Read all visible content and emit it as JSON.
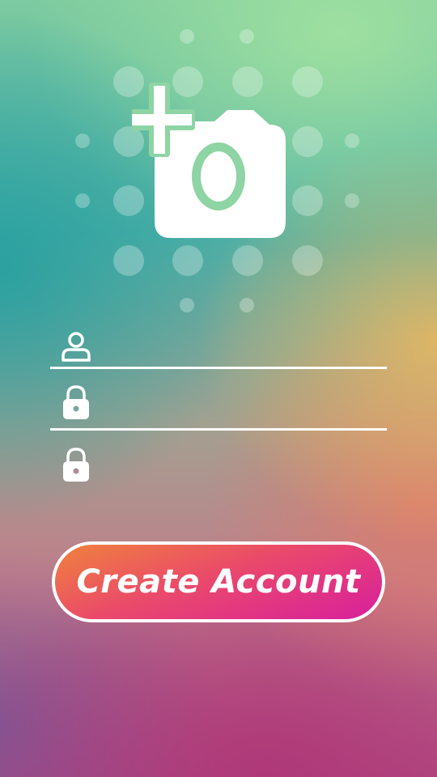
{
  "colors": {
    "accent_green": "#8fd4a4",
    "button_gradient_start": "#f0823c",
    "button_gradient_end": "#d81f9d",
    "line": "#ffffff"
  },
  "logo": {
    "icon": "add-photo-icon"
  },
  "form": {
    "username": {
      "icon": "user-icon",
      "value": "",
      "placeholder": ""
    },
    "password": {
      "icon": "lock-icon",
      "value": "",
      "placeholder": ""
    },
    "confirm_password": {
      "icon": "lock-icon",
      "value": "",
      "placeholder": ""
    }
  },
  "actions": {
    "create_account_label": "Create Account"
  }
}
